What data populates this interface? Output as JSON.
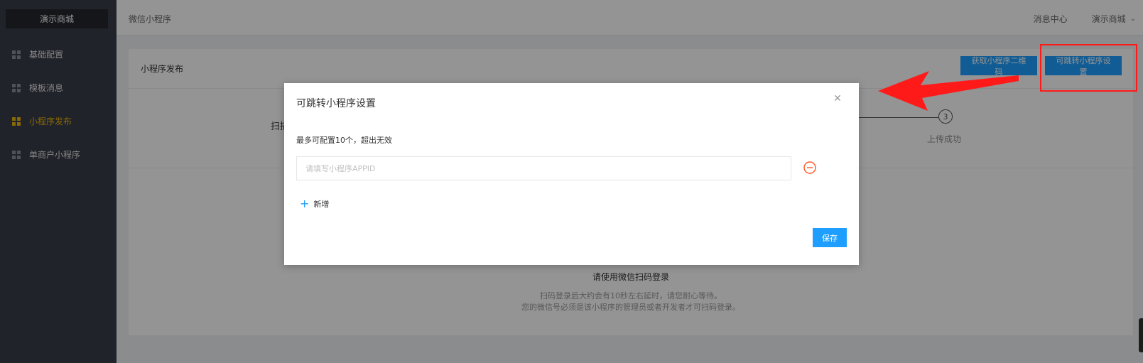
{
  "sidebar": {
    "brand": "演示商城",
    "items": [
      {
        "label": "基础配置",
        "active": false
      },
      {
        "label": "模板消息",
        "active": false
      },
      {
        "label": "小程序发布",
        "active": true
      },
      {
        "label": "单商户小程序",
        "active": false
      }
    ]
  },
  "topbar": {
    "breadcrumb": "微信小程序",
    "messages": "消息中心",
    "user": "演示商城"
  },
  "card": {
    "title": "小程序发布",
    "btn_qrcode": "获取小程序二维码",
    "btn_jump": "可跳转小程序设置",
    "step1_label": "扫描",
    "step3_number": "3",
    "step3_label": "上传成功",
    "login_title": "请使用微信扫码登录",
    "login_desc1": "扫码登录后大约会有10秒左右延时，请您耐心等待。",
    "login_desc2": "您的微信号必须是该小程序的管理员或者开发者才可扫码登录。"
  },
  "modal": {
    "title": "可跳转小程序设置",
    "hint": "最多可配置10个，超出无效",
    "input_value": "",
    "input_placeholder": "请填写小程序APPID",
    "add_label": "新增",
    "save_label": "保存"
  },
  "colors": {
    "sidebar_bg": "#393d49",
    "accent": "#1e9fff",
    "active": "#e8b50a",
    "annotation": "#ff1a1a"
  }
}
